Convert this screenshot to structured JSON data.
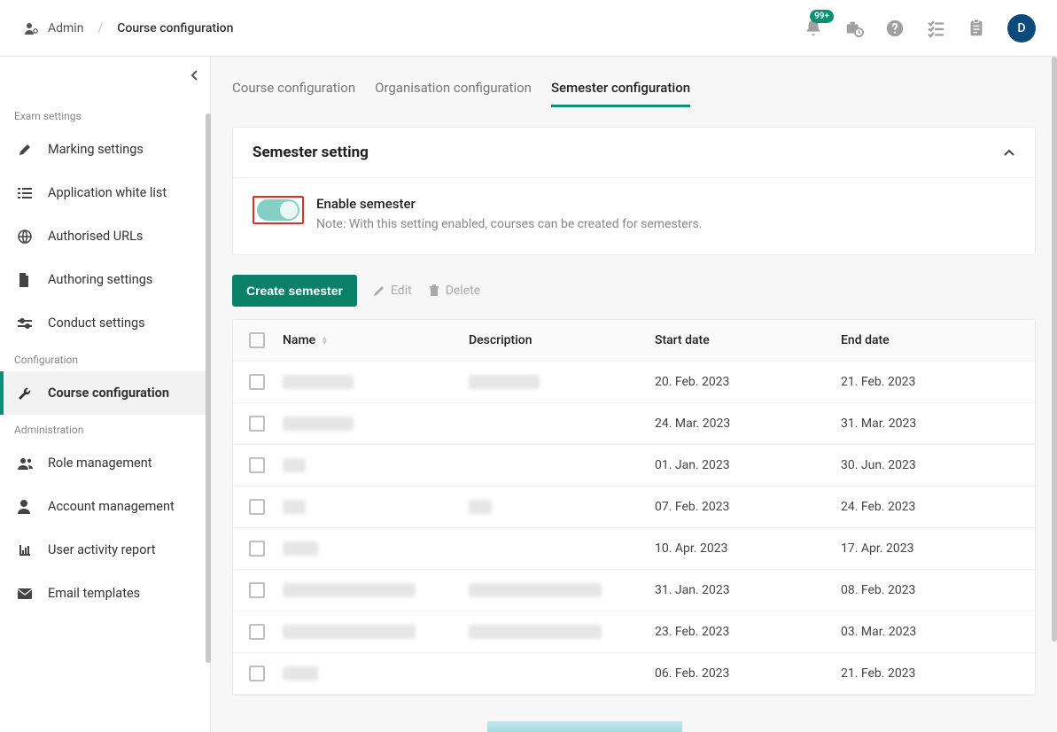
{
  "breadcrumb": {
    "root": "Admin",
    "current": "Course configuration"
  },
  "header": {
    "badge": "99+",
    "avatar_initial": "D"
  },
  "sidebar": {
    "sections": [
      {
        "title": "Exam settings",
        "items": [
          {
            "label": "Marking settings",
            "icon": "pen"
          },
          {
            "label": "Application white list",
            "icon": "list"
          },
          {
            "label": "Authorised URLs",
            "icon": "globe"
          },
          {
            "label": "Authoring settings",
            "icon": "file"
          },
          {
            "label": "Conduct settings",
            "icon": "sliders"
          }
        ]
      },
      {
        "title": "Configuration",
        "items": [
          {
            "label": "Course configuration",
            "icon": "wrench",
            "active": true
          }
        ]
      },
      {
        "title": "Administration",
        "items": [
          {
            "label": "Role management",
            "icon": "users"
          },
          {
            "label": "Account management",
            "icon": "user"
          },
          {
            "label": "User activity report",
            "icon": "chart"
          },
          {
            "label": "Email templates",
            "icon": "envelope"
          }
        ]
      }
    ]
  },
  "tabs": [
    {
      "label": "Course configuration",
      "active": false
    },
    {
      "label": "Organisation configuration",
      "active": false
    },
    {
      "label": "Semester configuration",
      "active": true
    }
  ],
  "card": {
    "title": "Semester setting",
    "toggle_label": "Enable semester",
    "note": "Note: With this setting enabled, courses can be created for semesters."
  },
  "actions": {
    "create": "Create semester",
    "edit": "Edit",
    "delete": "Delete"
  },
  "table": {
    "columns": {
      "name": "Name",
      "description": "Description",
      "start": "Start date",
      "end": "End date"
    },
    "rows": [
      {
        "name_blur": "w60",
        "desc_blur": "w60",
        "start": "20. Feb. 2023",
        "end": "21. Feb. 2023"
      },
      {
        "name_blur": "w60",
        "desc_blur": "",
        "start": "24. Mar. 2023",
        "end": "31. Mar. 2023"
      },
      {
        "name_blur": "w30",
        "desc_blur": "",
        "start": "01. Jan. 2023",
        "end": "30. Jun. 2023"
      },
      {
        "name_blur": "w30",
        "desc_blur": "w30",
        "start": "07. Feb. 2023",
        "end": "24. Feb. 2023"
      },
      {
        "name_blur": "w40",
        "desc_blur": "",
        "start": "10. Apr. 2023",
        "end": "17. Apr. 2023"
      },
      {
        "name_blur": "w150",
        "desc_blur": "w150",
        "start": "31. Jan. 2023",
        "end": "08. Feb. 2023"
      },
      {
        "name_blur": "w150",
        "desc_blur": "w150",
        "start": "23. Feb. 2023",
        "end": "03. Mar. 2023"
      },
      {
        "name_blur": "w40",
        "desc_blur": "",
        "start": "06. Feb. 2023",
        "end": "21. Feb. 2023"
      }
    ]
  }
}
